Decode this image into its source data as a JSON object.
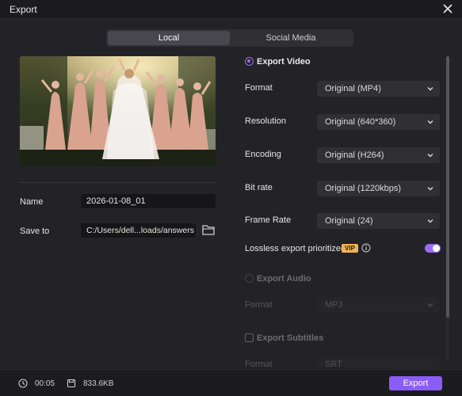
{
  "window": {
    "title": "Export"
  },
  "tabs": [
    {
      "label": "Local",
      "active": true
    },
    {
      "label": "Social Media",
      "active": false
    }
  ],
  "file": {
    "name_label": "Name",
    "name_value": "2026-01-08_01",
    "save_label": "Save to",
    "save_value": "C:/Users/dell...loads/answers"
  },
  "export_video": {
    "label": "Export Video",
    "selected": true,
    "rows": [
      {
        "label": "Format",
        "value": "Original (MP4)"
      },
      {
        "label": "Resolution",
        "value": "Original (640*360)"
      },
      {
        "label": "Encoding",
        "value": "Original (H264)"
      },
      {
        "label": "Bit rate",
        "value": "Original (1220kbps)"
      },
      {
        "label": "Frame Rate",
        "value": "Original (24)"
      }
    ],
    "lossless_label": "Lossless export prioritized",
    "vip_badge": "VIP",
    "lossless_enabled": true
  },
  "export_audio": {
    "label": "Export Audio",
    "selected": false,
    "format_label": "Format",
    "format_value": "MP3"
  },
  "export_subtitles": {
    "label": "Export Subtitles",
    "checked": false,
    "format_label": "Format",
    "format_value": "SRT"
  },
  "footer": {
    "duration": "00:05",
    "size": "833.6KB",
    "export_label": "Export"
  },
  "colors": {
    "accent": "#8b5cf6",
    "vip": "#f0b25a",
    "background": "#232327"
  }
}
